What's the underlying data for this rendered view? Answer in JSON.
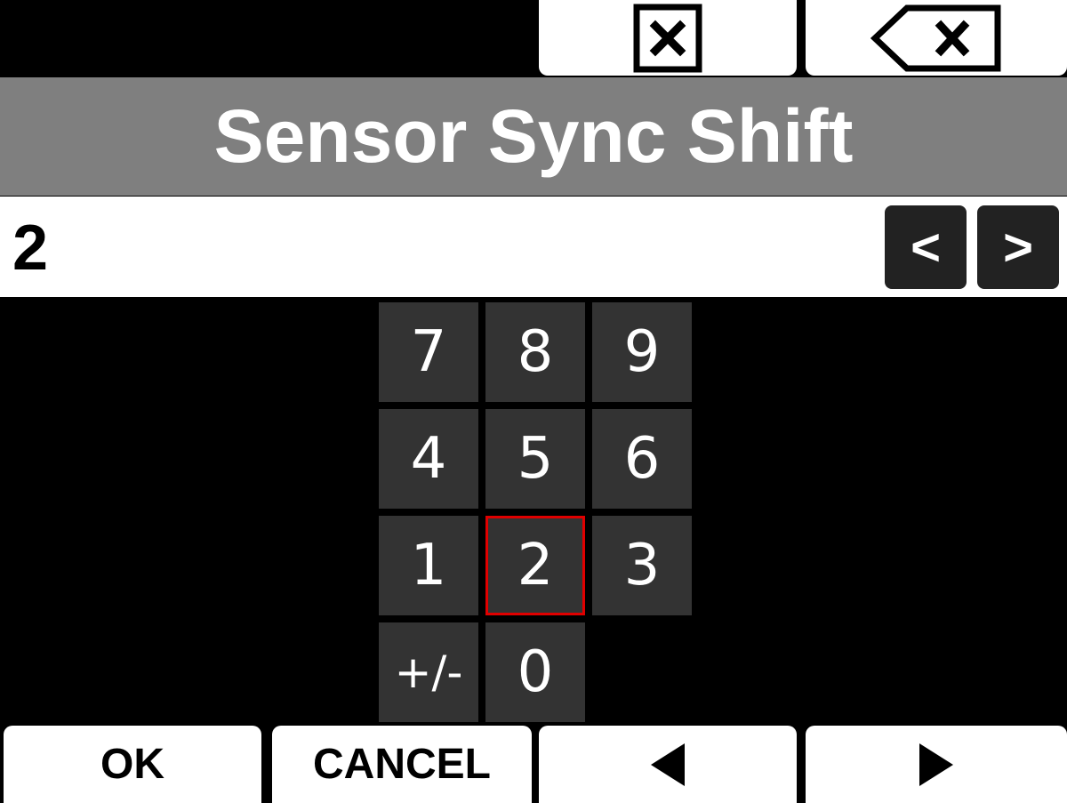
{
  "top_bar": {
    "clear_icon": "clear-box-icon",
    "backspace_icon": "backspace-icon"
  },
  "title": "Sensor Sync Shift",
  "value": "2",
  "cursor": {
    "left_label": "<",
    "right_label": ">"
  },
  "keypad": {
    "keys": [
      "7",
      "8",
      "9",
      "4",
      "5",
      "6",
      "1",
      "2",
      "3",
      "+/-",
      "0"
    ],
    "selected": "2"
  },
  "bottom_bar": {
    "ok_label": "OK",
    "cancel_label": "CANCEL",
    "prev_icon": "triangle-left-icon",
    "next_icon": "triangle-right-icon"
  },
  "colors": {
    "title_bg": "#7f7f7f",
    "key_bg": "#333333",
    "selection": "#e00000"
  }
}
